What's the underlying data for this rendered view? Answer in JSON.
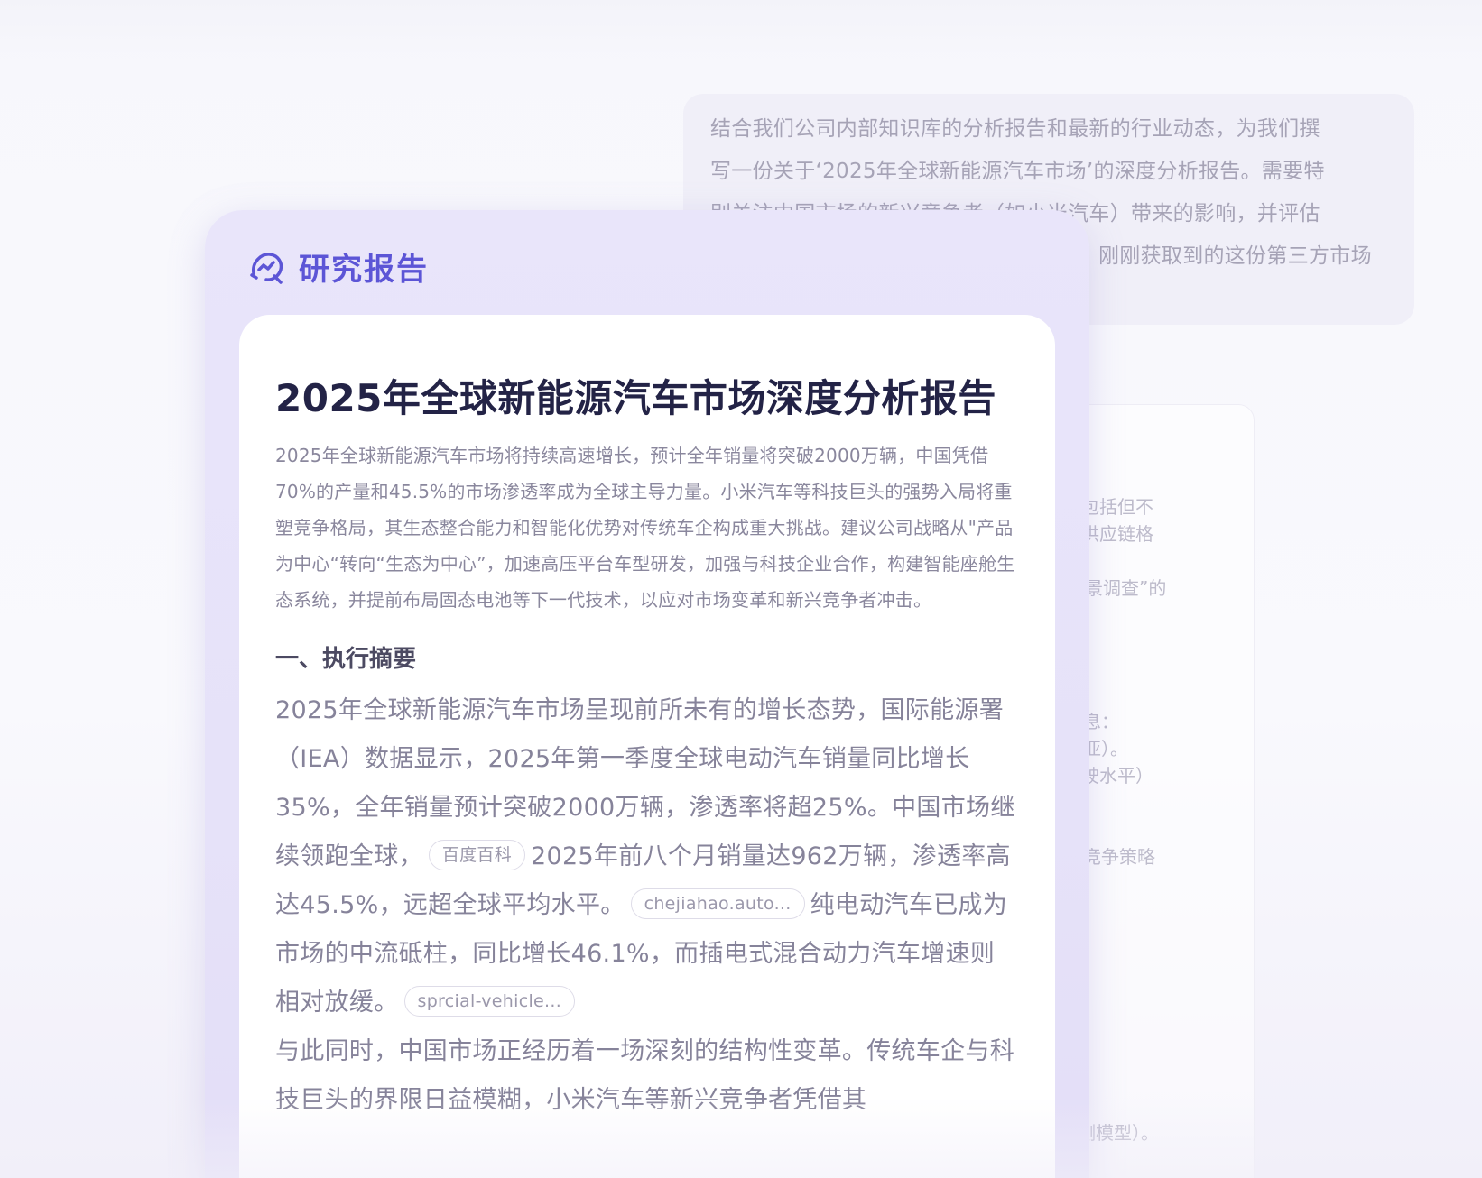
{
  "prompt": {
    "lines": [
      "结合我们公司内部知识库的分析报告和最新的行业动态，为我们撰",
      "写一份关于‘2025年全球新能源汽车市场’的深度分析报告。需要特",
      "别关注中国市场的新兴竞争者（如小米汽车）带来的影响，并评估",
      "刚刚获取到的这份第三方市场"
    ]
  },
  "background_fragments": [
    "，包括但不",
    "、供应链格",
    "全景调查”的",
    "信息：",
    "南亚）。",
    "驾驶水平）",
    "的竞争策略",
    "。",
    "预测模型）。"
  ],
  "panel": {
    "title": "研究报告",
    "icon": "research-chart-search-icon",
    "accent_color": "#5c55d6"
  },
  "report": {
    "title": "2025年全球新能源汽车市场深度分析报告",
    "summary": "2025年全球新能源汽车市场将持续高速增长，预计全年销量将突破2000万辆，中国凭借70%的产量和45.5%的市场渗透率成为全球主导力量。小米汽车等科技巨头的强势入局将重塑竞争格局，其生态整合能力和智能化优势对传统车企构成重大挑战。建议公司战略从\"产品为中心“转向“生态为中心”，加速高压平台车型研发，加强与科技企业合作，构建智能座舱生态系统，并提前布局固态电池等下一代技术，以应对市场变革和新兴竞争者冲击。",
    "section1": {
      "heading": "一、执行摘要",
      "p1_a": "2025年全球新能源汽车市场呈现前所未有的增长态势，国际能源署（IEA）数据显示，2025年第一季度全球电动汽车销量同比增长35%，全年销量预计突破2000万辆，渗透率将超25%。中国市场继续领跑全球，",
      "cite1": "百度百科",
      "p1_b": "2025年前八个月销量达962万辆，渗透率高达45.5%，远超全球平均水平。",
      "cite2": "chejiahao.auto...",
      "p1_c": "纯电动汽车已成为市场的中流砥柱，同比增长46.1%，而插电式混合动力汽车增速则相对放缓。",
      "cite3": "sprcial-vehicle...",
      "p2": "与此同时，中国市场正经历着一场深刻的结构性变革。传统车企与科技巨头的界限日益模糊，小米汽车等新兴竞争者凭借其"
    }
  }
}
